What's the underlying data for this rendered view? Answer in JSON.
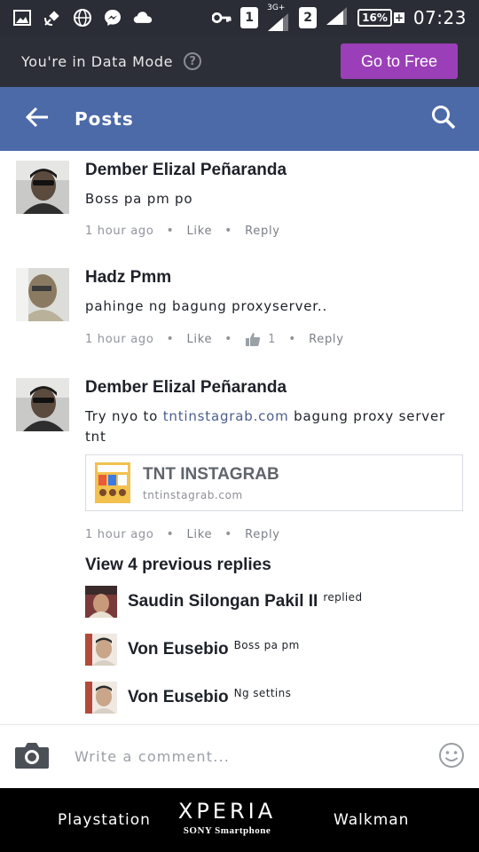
{
  "status_bar": {
    "sim1": "1",
    "sim2": "2",
    "network_type": "3G+",
    "battery": "16%",
    "time": "07:23"
  },
  "data_banner": {
    "text": "You're in Data Mode",
    "help_glyph": "?",
    "cta_label": "Go to Free",
    "cta_color": "#9b3fb8"
  },
  "header": {
    "title": "Posts",
    "bar_color": "#4c69a8"
  },
  "comments": [
    {
      "name": "Dember Elizal Peñaranda",
      "text": "Boss pa pm po",
      "time": "1 hour ago",
      "like": "Like",
      "reply": "Reply"
    },
    {
      "name": "Hadz Pmm",
      "text": "pahinge ng bagung proxyserver..",
      "time": "1 hour ago",
      "like": "Like",
      "like_count": "1",
      "reply": "Reply"
    },
    {
      "name": "Dember Elizal Peñaranda",
      "text_prefix": "Try nyo to ",
      "text_link": "tntinstagrab.com",
      "text_suffix": " bagung proxy server tnt",
      "link_card": {
        "title": "TNT INSTAGRAB",
        "url": "tntinstagrab.com"
      },
      "time": "1 hour ago",
      "like": "Like",
      "reply": "Reply"
    }
  ],
  "previous_replies_label": "View 4 previous replies",
  "replies": [
    {
      "name": "Saudin Silongan Pakil II",
      "text": "replied"
    },
    {
      "name": "Von Eusebio",
      "text": "Boss pa pm"
    },
    {
      "name": "Von Eusebio",
      "text": "Ng settins"
    }
  ],
  "composer": {
    "placeholder": "Write a comment..."
  },
  "brand_bar": {
    "left": "Playstation",
    "center_logo": "XPERIA",
    "center_sub": "SONY Smartphone",
    "right": "Walkman"
  },
  "icons": [
    "image-icon",
    "satellite-icon",
    "globe-icon",
    "messenger-icon",
    "cloud-icon",
    "key-icon",
    "signal-icon",
    "back-arrow-icon",
    "search-icon",
    "thumbs-up-icon",
    "camera-icon",
    "smiley-icon"
  ]
}
